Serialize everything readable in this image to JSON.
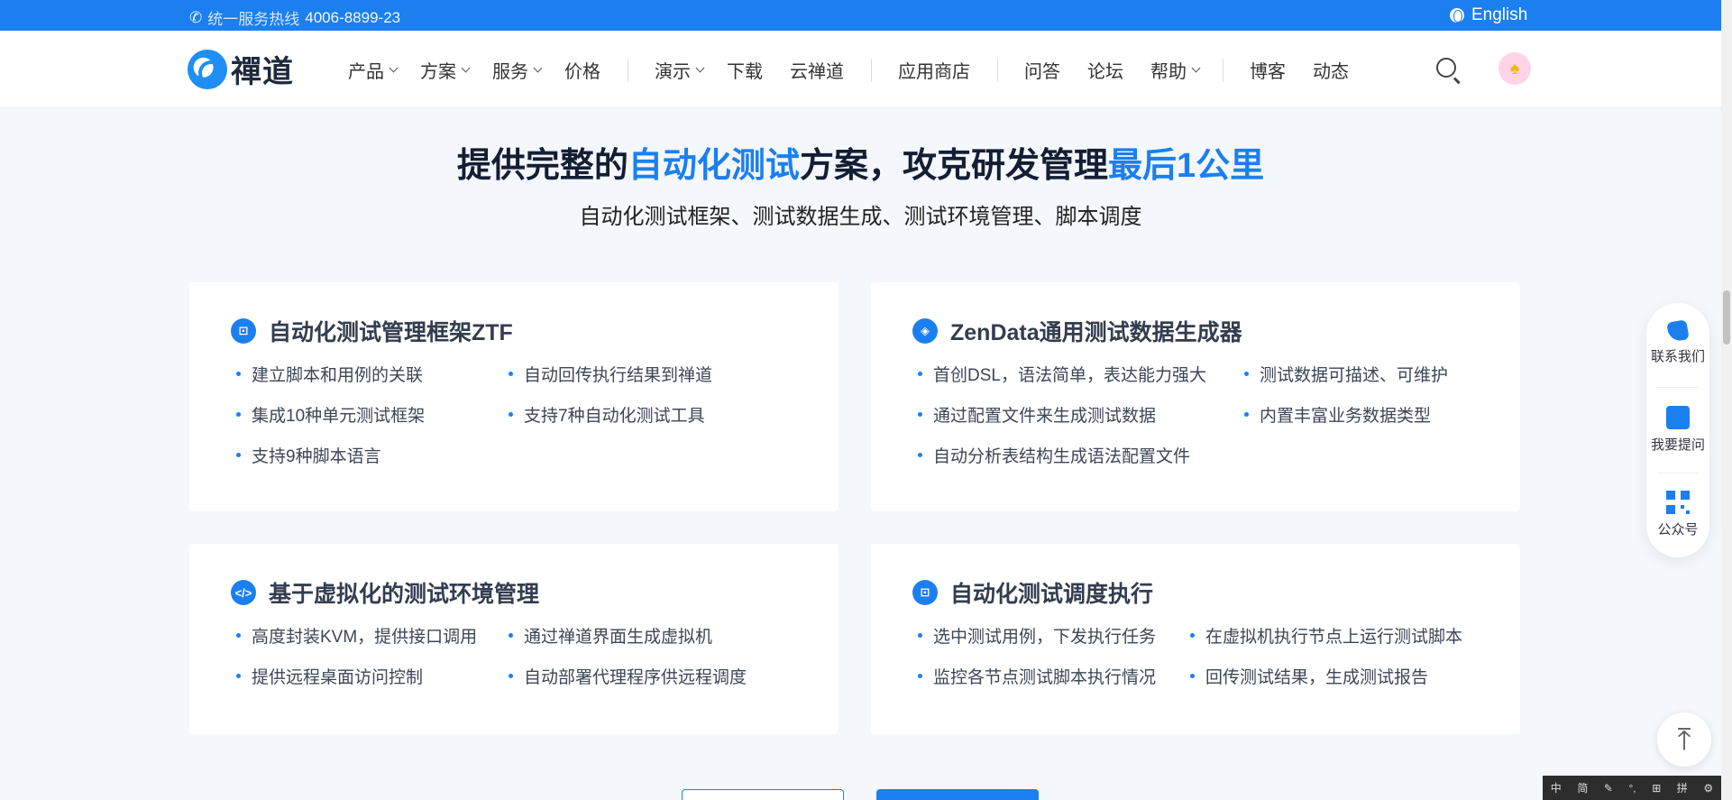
{
  "topbar": {
    "hotline_label": "统一服务热线",
    "hotline_number": "4006-8899-23",
    "language": "English"
  },
  "nav": {
    "logo_text": "禪道",
    "menu": [
      {
        "label": "产品",
        "dropdown": true
      },
      {
        "label": "方案",
        "dropdown": true
      },
      {
        "label": "服务",
        "dropdown": true
      },
      {
        "label": "价格",
        "dropdown": false
      },
      {
        "label": "演示",
        "dropdown": true
      },
      {
        "label": "下载",
        "dropdown": false
      },
      {
        "label": "云禅道",
        "dropdown": false
      },
      {
        "label": "应用商店",
        "dropdown": false
      },
      {
        "label": "问答",
        "dropdown": false
      },
      {
        "label": "论坛",
        "dropdown": false
      },
      {
        "label": "帮助",
        "dropdown": true
      },
      {
        "label": "博客",
        "dropdown": false
      },
      {
        "label": "动态",
        "dropdown": false
      }
    ]
  },
  "hero": {
    "title_p1": "提供完整的",
    "title_hl1": "自动化测试",
    "title_p2": "方案，攻克研发管理",
    "title_hl2": "最后1公里",
    "subtitle": "自动化测试框架、测试数据生成、测试环境管理、脚本调度"
  },
  "cards": [
    {
      "title": "自动化测试管理框架ZTF",
      "icon": "robot-icon",
      "features": [
        "建立脚本和用例的关联",
        "自动回传执行结果到禅道",
        "集成10种单元测试框架",
        "支持7种自动化测试工具",
        "支持9种脚本语言"
      ]
    },
    {
      "title": "ZenData通用测试数据生成器",
      "icon": "cube-icon",
      "features": [
        "首创DSL，语法简单，表达能力强大",
        "测试数据可描述、可维护",
        "通过配置文件来生成测试数据",
        "内置丰富业务数据类型",
        "自动分析表结构生成语法配置文件"
      ]
    },
    {
      "title": "基于虚拟化的测试环境管理",
      "icon": "code-icon",
      "features": [
        "高度封装KVM，提供接口调用",
        "通过禅道界面生成虚拟机",
        "提供远程桌面访问控制",
        "自动部署代理程序供远程调度"
      ]
    },
    {
      "title": "自动化测试调度执行",
      "icon": "robot-icon",
      "features": [
        "选中测试用例，下发执行任务",
        "在虚拟机执行节点上运行测试脚本",
        "监控各节点测试脚本执行情况",
        "回传测试结果，生成测试报告"
      ]
    }
  ],
  "float_panel": {
    "contact": "联系我们",
    "ask": "我要提问",
    "wechat": "公众号"
  },
  "ime": [
    "中",
    "简",
    "✎",
    "°,",
    "⊞",
    "拼",
    "⚙"
  ],
  "colors": {
    "brand": "#1b7ff0",
    "background": "#f4f7fc"
  }
}
